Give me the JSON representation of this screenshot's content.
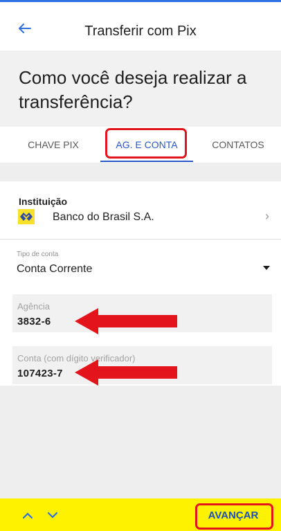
{
  "header": {
    "title": "Transferir com Pix",
    "back_icon": "arrow-left-icon"
  },
  "question": "Como você deseja realizar a transferência?",
  "tabs": [
    {
      "label": "CHAVE PIX",
      "active": false
    },
    {
      "label": "AG. E CONTA",
      "active": true
    },
    {
      "label": "CONTATOS",
      "active": false
    }
  ],
  "form": {
    "institution_label": "Instituição",
    "bank_name": "Banco do Brasil S.A.",
    "bank_logo_icon": "banco-do-brasil-logo-icon",
    "chevron_icon": "chevron-right-icon",
    "account_type": {
      "label": "Tipo de conta",
      "value": "Conta Corrente",
      "icon": "dropdown-caret-icon"
    },
    "agencia": {
      "label": "Agência",
      "value": "3832-6"
    },
    "conta": {
      "label": "Conta (com dígito verificador)",
      "value": "107423-7"
    }
  },
  "bottom_bar": {
    "prev_icon": "chevron-up-icon",
    "next_icon": "chevron-down-icon",
    "advance_label": "AVANÇAR"
  },
  "colors": {
    "accent_blue": "#2a58c9",
    "yellow_bar": "#fff200",
    "highlight_red": "#e3141b",
    "bank_logo_yellow": "#f9e02a",
    "bank_logo_blue": "#2f49a6"
  }
}
